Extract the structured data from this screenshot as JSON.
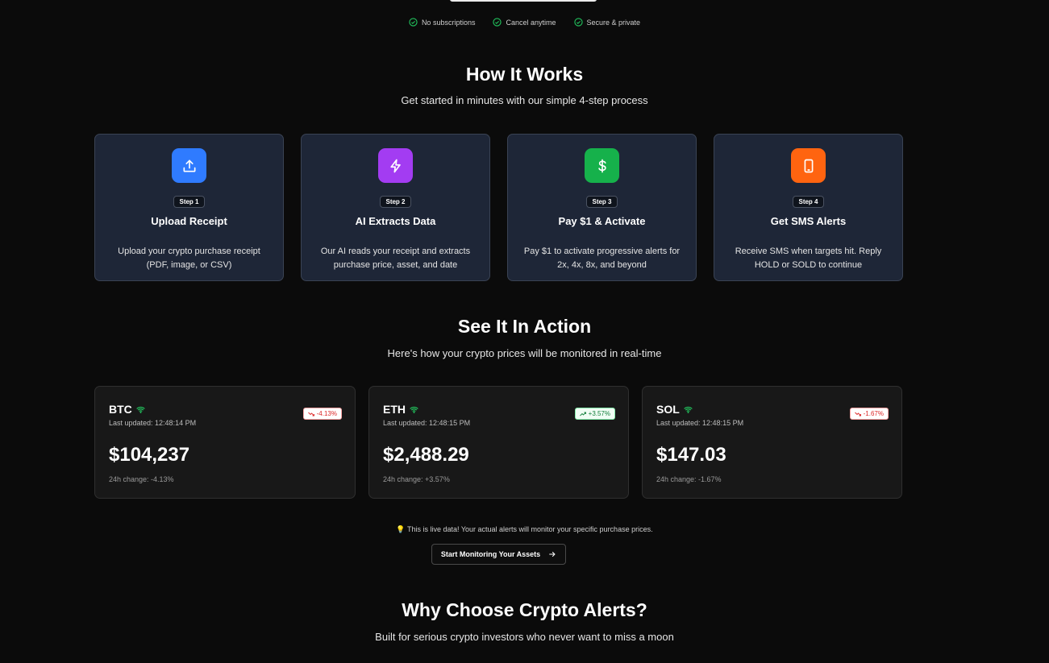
{
  "badges": [
    {
      "label": "No subscriptions",
      "icon": "check-circle-icon"
    },
    {
      "label": "Cancel anytime",
      "icon": "check-circle-icon"
    },
    {
      "label": "Secure & private",
      "icon": "check-circle-icon"
    }
  ],
  "how_it_works": {
    "title": "How It Works",
    "subtitle": "Get started in minutes with our simple 4-step process",
    "steps": [
      {
        "badge": "Step 1",
        "title": "Upload Receipt",
        "desc": "Upload your crypto purchase receipt (PDF, image, or CSV)",
        "icon": "upload-icon",
        "color": "#2f7bff"
      },
      {
        "badge": "Step 2",
        "title": "AI Extracts Data",
        "desc": "Our AI reads your receipt and extracts purchase price, asset, and date",
        "icon": "lightning-icon",
        "color": "#a33cf2"
      },
      {
        "badge": "Step 3",
        "title": "Pay $1 & Activate",
        "desc": "Pay $1 to activate progressive alerts for 2x, 4x, 8x, and beyond",
        "icon": "dollar-icon",
        "color": "#16b14b"
      },
      {
        "badge": "Step 4",
        "title": "Get SMS Alerts",
        "desc": "Receive SMS when targets hit. Reply HOLD or SOLD to continue",
        "icon": "phone-icon",
        "color": "#ff6410"
      }
    ]
  },
  "in_action": {
    "title": "See It In Action",
    "subtitle": "Here's how your crypto prices will be monitored in real-time",
    "cards": [
      {
        "symbol": "BTC",
        "updated": "Last updated: 12:48:14 PM",
        "pill": "-4.13%",
        "direction": "down",
        "price": "$104,237",
        "change": "24h change: -4.13%"
      },
      {
        "symbol": "ETH",
        "updated": "Last updated: 12:48:15 PM",
        "pill": "+3.57%",
        "direction": "up",
        "price": "$2,488.29",
        "change": "24h change: +3.57%"
      },
      {
        "symbol": "SOL",
        "updated": "Last updated: 12:48:15 PM",
        "pill": "-1.67%",
        "direction": "down",
        "price": "$147.03",
        "change": "24h change: -1.67%"
      }
    ],
    "note": "This is live data! Your actual alerts will monitor your specific purchase prices.",
    "cta_label": "Start Monitoring Your Assets"
  },
  "why": {
    "title": "Why Choose Crypto Alerts?",
    "subtitle": "Built for serious crypto investors who never want to miss a moon"
  },
  "colors": {
    "check": "#22c55e",
    "down": "#dc2626",
    "up": "#15803d",
    "wifi": "#22c55e"
  }
}
